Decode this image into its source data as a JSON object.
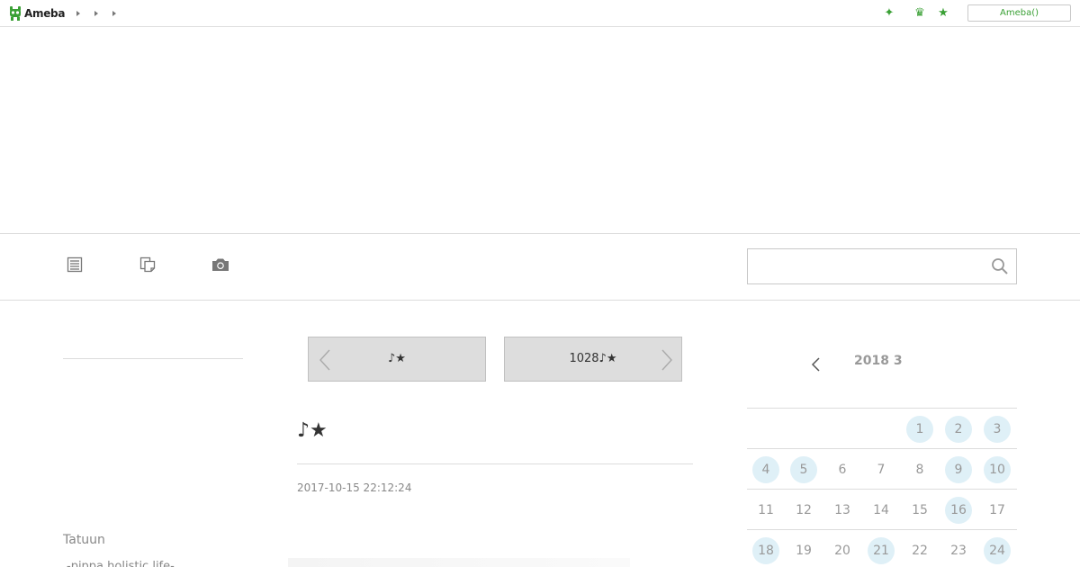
{
  "topbar": {
    "logo_text": "Ameba",
    "login_label": "Ameba()",
    "icons": [
      "sparkle-icon",
      "crown-icon",
      "star-icon"
    ],
    "icon_glyphs": [
      "✦",
      "♛",
      "★"
    ],
    "accent_color": "#3aa035"
  },
  "nav": {
    "icons": [
      "entry-list-icon",
      "theme-list-icon",
      "photo-icon"
    ],
    "search_placeholder": ""
  },
  "sidebar": {
    "name": "Tatuun",
    "tagline": "-pippa holistic life-"
  },
  "pager": {
    "prev_label": "♪★",
    "next_label": "1028♪★"
  },
  "entry": {
    "title": "♪★",
    "date": "2017-10-15 22:12:24"
  },
  "calendar": {
    "title": "2018 3",
    "highlight_color": "#dff0f7",
    "weeks": [
      [
        {
          "d": "",
          "has": false
        },
        {
          "d": "",
          "has": false
        },
        {
          "d": "",
          "has": false
        },
        {
          "d": "",
          "has": false
        },
        {
          "d": "1",
          "has": true
        },
        {
          "d": "2",
          "has": true
        },
        {
          "d": "3",
          "has": true
        }
      ],
      [
        {
          "d": "4",
          "has": true
        },
        {
          "d": "5",
          "has": true
        },
        {
          "d": "6",
          "has": false
        },
        {
          "d": "7",
          "has": false
        },
        {
          "d": "8",
          "has": false
        },
        {
          "d": "9",
          "has": true
        },
        {
          "d": "10",
          "has": true
        }
      ],
      [
        {
          "d": "11",
          "has": false
        },
        {
          "d": "12",
          "has": false
        },
        {
          "d": "13",
          "has": false
        },
        {
          "d": "14",
          "has": false
        },
        {
          "d": "15",
          "has": false
        },
        {
          "d": "16",
          "has": true
        },
        {
          "d": "17",
          "has": false
        }
      ],
      [
        {
          "d": "18",
          "has": true
        },
        {
          "d": "19",
          "has": false
        },
        {
          "d": "20",
          "has": false
        },
        {
          "d": "21",
          "has": true
        },
        {
          "d": "22",
          "has": false
        },
        {
          "d": "23",
          "has": false
        },
        {
          "d": "24",
          "has": true
        }
      ]
    ]
  }
}
